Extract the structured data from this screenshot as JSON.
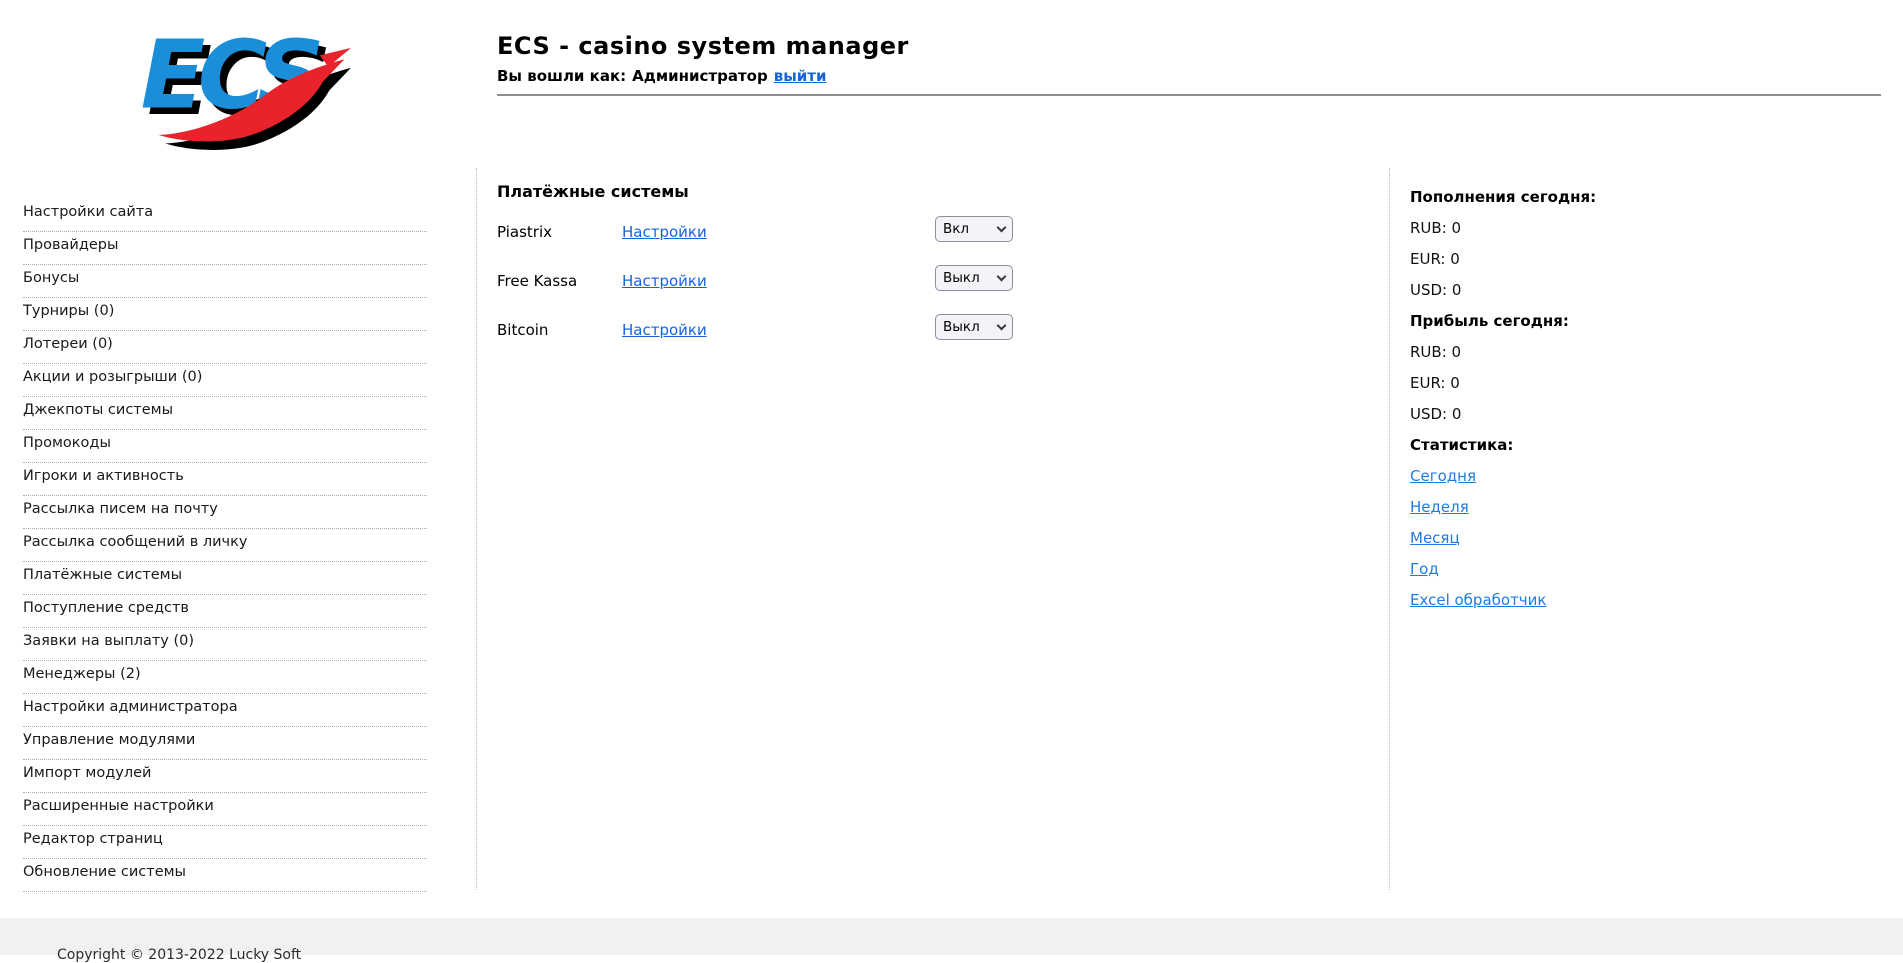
{
  "header": {
    "logo_text": "ECS",
    "title": "ECS - casino system manager",
    "login_prefix": "Вы вошли как:",
    "login_user": "Администратор",
    "logout_label": "выйти"
  },
  "sidebar": {
    "items": [
      "Настройки сайта",
      "Провайдеры",
      "Бонусы",
      "Турниры (0)",
      "Лотереи (0)",
      "Акции и розыгрыши (0)",
      "Джекпоты системы",
      "Промокоды",
      "Игроки и активность",
      "Рассылка писем на почту",
      "Рассылка сообщений в личку",
      "Платёжные системы",
      "Поступление средств",
      "Заявки на выплату (0)",
      "Менеджеры (2)",
      "Настройки администратора",
      "Управление модулями",
      "Импорт модулей",
      "Расширенные настройки",
      "Редактор страниц",
      "Обновление системы"
    ]
  },
  "main": {
    "heading": "Платёжные системы",
    "select_options": [
      "Вкл",
      "Выкл"
    ],
    "rows": [
      {
        "name": "Piastrix",
        "settings_label": "Настройки",
        "state": "Вкл"
      },
      {
        "name": "Free Kassa",
        "settings_label": "Настройки",
        "state": "Выкл"
      },
      {
        "name": "Bitcoin",
        "settings_label": "Настройки",
        "state": "Выкл"
      }
    ]
  },
  "stats_panel": {
    "deposits_header": "Пополнения сегодня:",
    "deposits": [
      "RUB: 0",
      "EUR: 0",
      "USD: 0"
    ],
    "profit_header": "Прибыль сегодня:",
    "profit": [
      "RUB: 0",
      "EUR: 0",
      "USD: 0"
    ],
    "stats_header": "Статистика:",
    "links": [
      "Сегодня",
      "Неделя",
      "Месяц",
      "Год",
      "Excel обработчик"
    ]
  },
  "footer": {
    "copyright": "Copyright © 2013-2022 Lucky Soft"
  },
  "colors": {
    "logo_blue": "#1b8ed9",
    "logo_red": "#e8232b",
    "link_blue": "#1565d8",
    "stats_link_blue": "#1e7ce0",
    "footer_bg": "#f1f1f1"
  }
}
